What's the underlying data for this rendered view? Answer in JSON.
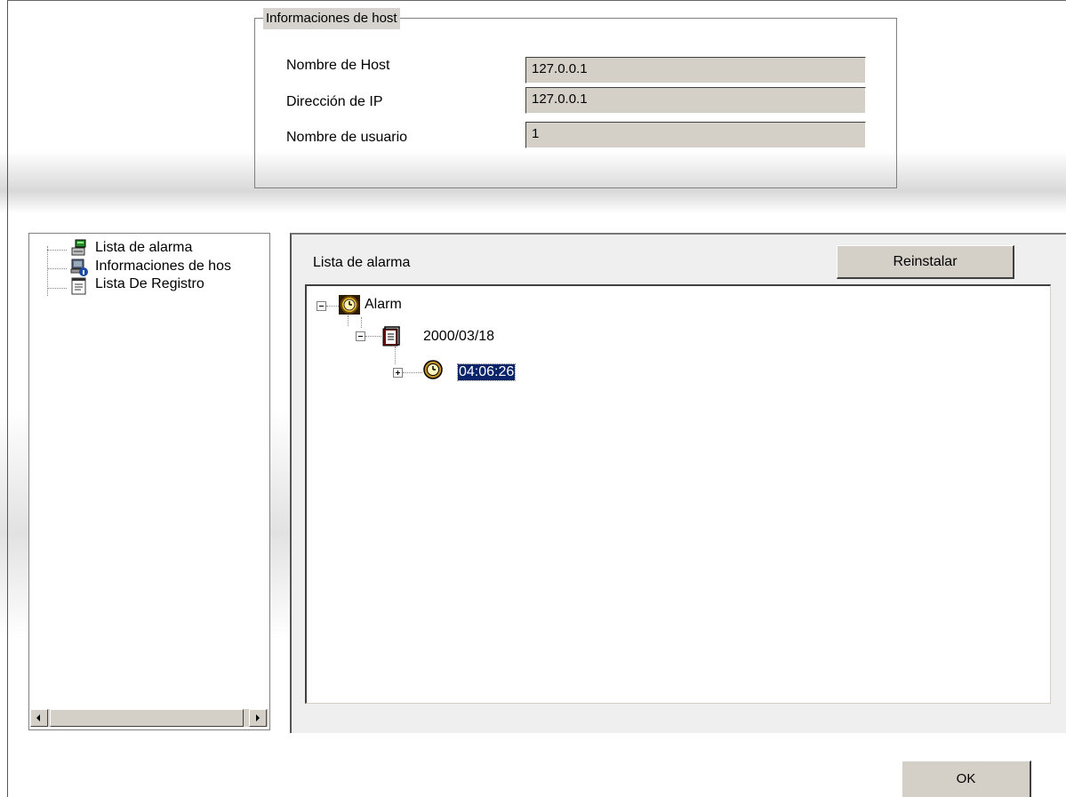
{
  "host_info": {
    "title": "Informaciones de host",
    "hostname_label": "Nombre de Host",
    "hostname_value": "127.0.0.1",
    "ip_label": "Dirección de IP",
    "ip_value": "127.0.0.1",
    "user_label": "Nombre de usuario",
    "user_value": "1"
  },
  "nav": {
    "items": [
      {
        "label": "Lista de alarma",
        "icon": "alarm-list-icon"
      },
      {
        "label": "Informaciones de hos",
        "icon": "host-info-icon"
      },
      {
        "label": "Lista De Registro",
        "icon": "log-list-icon"
      }
    ]
  },
  "alarm_panel": {
    "title": "Lista de alarma",
    "reset_label": "Reinstalar",
    "tree": {
      "root": {
        "label": "Alarm",
        "icon": "alarm-clock-icon"
      },
      "date": {
        "label": "2000/03/18",
        "icon": "notepad-icon"
      },
      "time": {
        "label": "04:06:26",
        "icon": "clock-icon",
        "selected": true
      }
    }
  },
  "ok_label": "OK"
}
